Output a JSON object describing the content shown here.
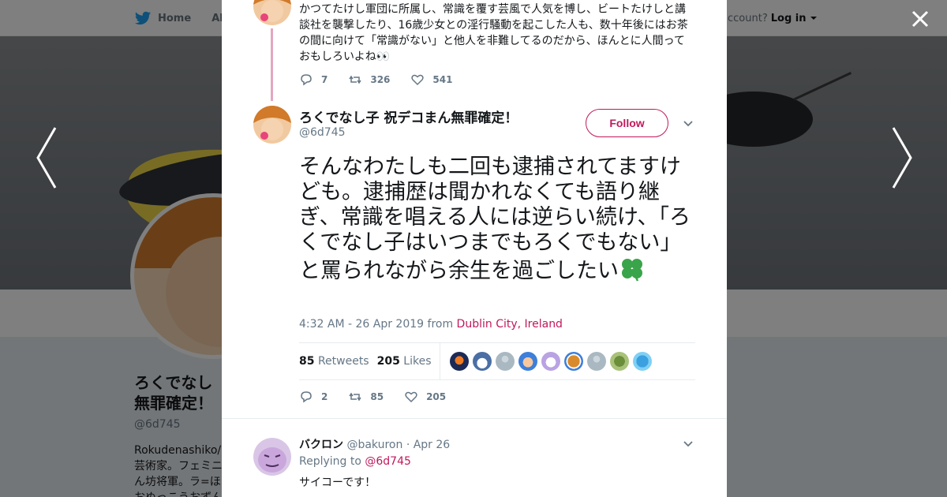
{
  "background": {
    "nav_home": "Home",
    "nav_about": "Abo",
    "login_prompt": "ccount?",
    "login_label": "Log in",
    "profile_name_line1": "ろくでなし",
    "profile_name_line2": "無罪確定！",
    "profile_handle": "@6d745",
    "bio_line1": "Rokudenashiko/ M",
    "bio_line2": "芸術家。フェミニ",
    "bio_line3": "ん坊将軍。ラ=ほ",
    "bio_line4": "おぬっこうおずんこ"
  },
  "previous_tweet": {
    "text": "かつてたけし軍団に所属し、常識を覆す芸風で人気を博し、ビートたけしと講談社を襲撃したり、16歳少女との淫行騒動を起こした人も、数十年後にはお茶の間に向けて「常識がない」と他人を非難してるのだから、ほんとに人間っておもしろいよね👀",
    "replies": "7",
    "retweets": "326",
    "likes": "541"
  },
  "tweet": {
    "display_name": "ろくでなし子 祝デコまん無罪確定！",
    "handle": "@6d745",
    "follow_label": "Follow",
    "text": "そんなわたしも二回も逮捕されてますけども。逮捕歴は聞かれなくても語り継ぎ、常識を唱える人には逆らい続け、「ろくでなし子はいつまでもろくでもない」と罵られながら余生を過ごしたい",
    "timestamp": "4:32 AM - 26 Apr 2019 from",
    "location": "Dublin City, Ireland",
    "retweets_count": "85",
    "retweets_label": "Retweets",
    "likes_count": "205",
    "likes_label": "Likes",
    "replies": "2",
    "retweets": "85",
    "likes": "205"
  },
  "reply": {
    "display_name": "バクロン",
    "handle": "@bakuron",
    "date": "· Apr 26",
    "replying_to_label": "Replying to",
    "replying_to_handle": "@6d745",
    "text": "サイコーです！"
  },
  "colors": {
    "accent": "#c1185c",
    "thread_line": "#e3a7c0",
    "muted": "#657786"
  },
  "icons": [
    "twitter-bird-icon",
    "chevron-down-icon",
    "close-icon",
    "arrow-left-icon",
    "arrow-right-icon",
    "reply-icon",
    "retweet-icon",
    "like-icon",
    "clover-icon"
  ]
}
